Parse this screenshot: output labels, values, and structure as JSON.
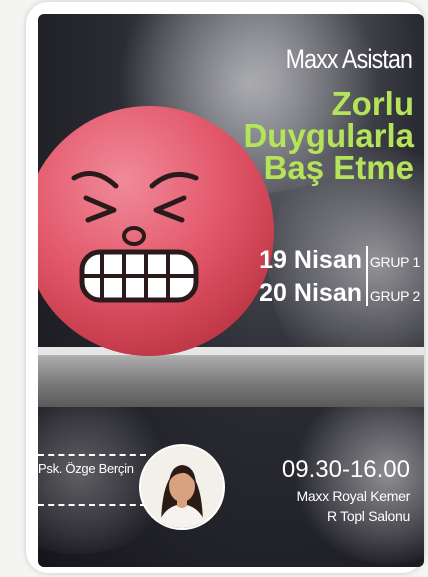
{
  "poster": {
    "brand": "Maxx Asistan",
    "title_lines": [
      "Zorlu",
      "Duygularla",
      "Baş Etme"
    ],
    "sessions": [
      {
        "date": "19 Nisan",
        "group": "GRUP 1"
      },
      {
        "date": "20 Nisan",
        "group": "GRUP 2"
      }
    ],
    "time": "09.30-16.00",
    "venue_lines": [
      "Maxx Royal  Kemer",
      "R Topl Salonu"
    ],
    "speaker": "Psk. Özge Berçin"
  },
  "colors": {
    "title_accent": "#b5e35a",
    "ball": "#e25669",
    "background": "#1c1c22"
  },
  "icons": {
    "stress-ball": "angry face ball illustration",
    "speaker-photo": "portrait of speaker"
  }
}
